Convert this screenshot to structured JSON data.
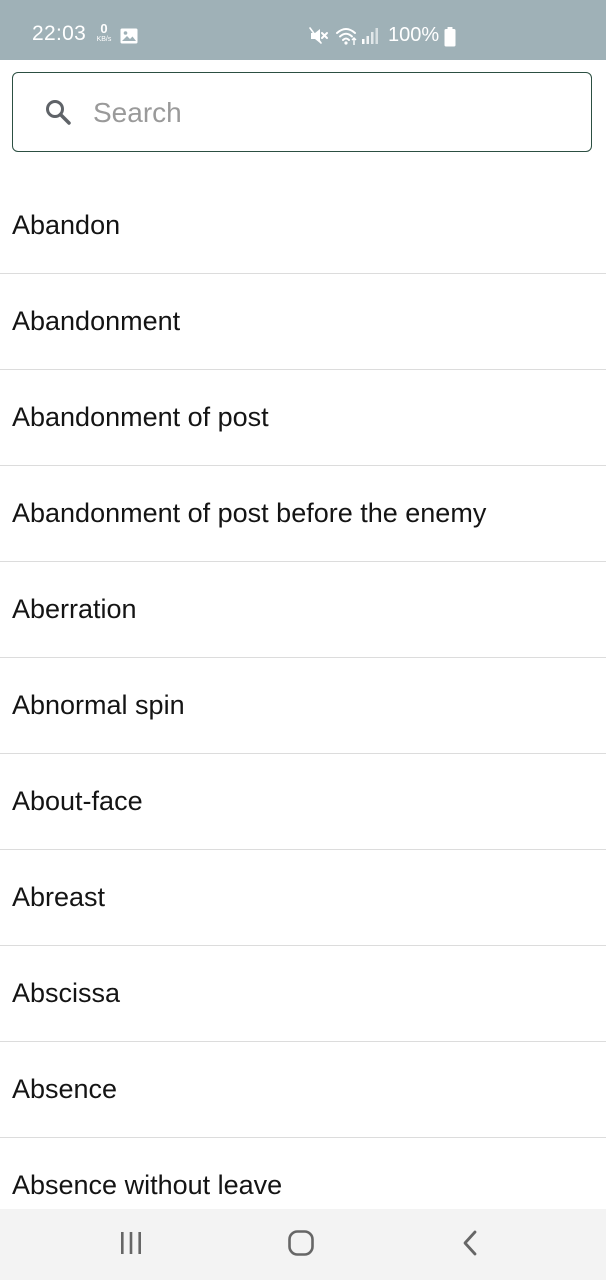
{
  "status_bar": {
    "time": "22:03",
    "net_speed_value": "0",
    "net_speed_unit": "KB/s",
    "battery": "100%",
    "icons": [
      "gallery-icon",
      "mute-icon",
      "wifi-icon",
      "signal-icon",
      "battery-icon"
    ]
  },
  "search": {
    "placeholder": "Search",
    "value": ""
  },
  "terms": [
    "Abandon",
    "Abandonment",
    "Abandonment of post",
    "Abandonment of post before the enemy",
    "Aberration",
    "Abnormal spin",
    "About-face",
    "Abreast",
    "Abscissa",
    "Absence",
    "Absence without leave"
  ],
  "nav_bar": {
    "buttons": [
      "recent-apps",
      "home",
      "back"
    ]
  },
  "colors": {
    "status_bar_bg": "#9fb1b7",
    "search_border": "#2c4f42",
    "divider": "#dcdcdc",
    "nav_bar_bg": "#f3f3f3"
  }
}
